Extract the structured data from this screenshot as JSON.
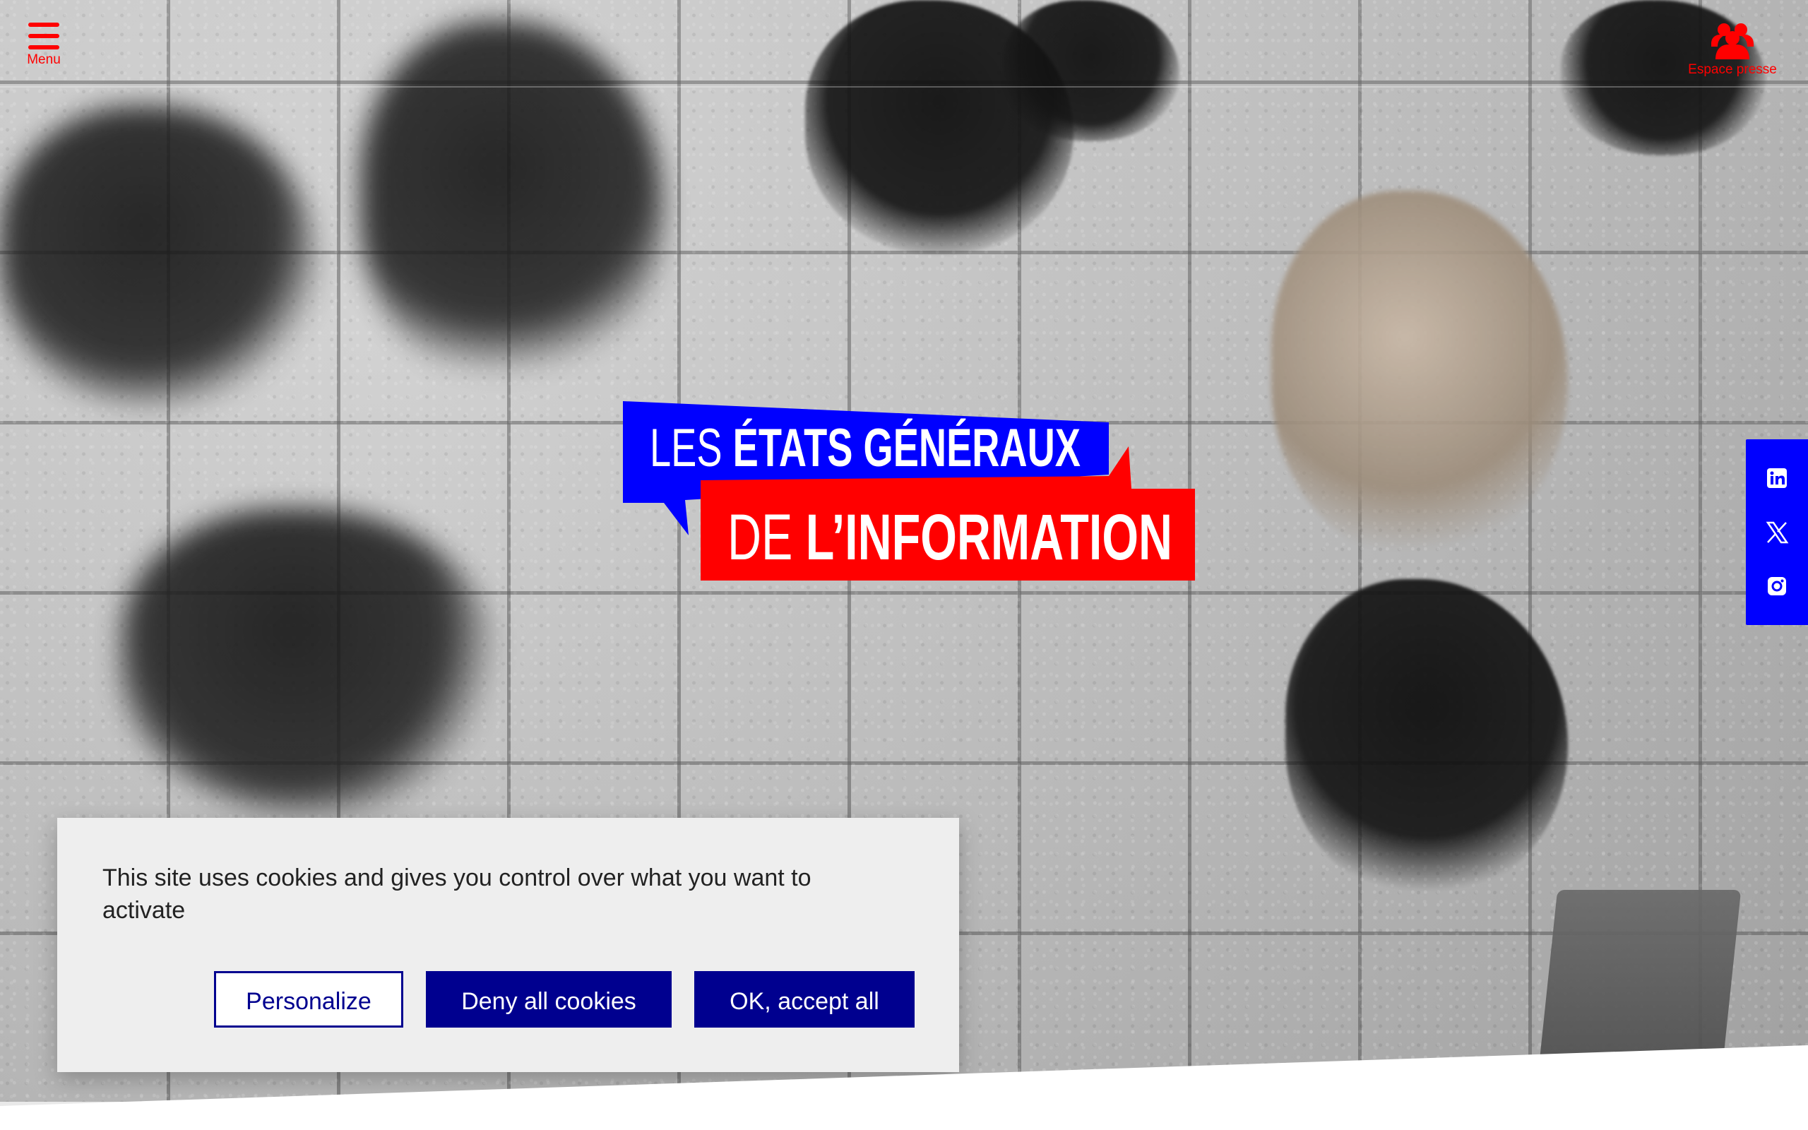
{
  "header": {
    "menu_label": "Menu",
    "press_label": "Espace presse"
  },
  "icons": {
    "menu": "menu-icon",
    "press": "press-group-icon",
    "linkedin": "linkedin-icon",
    "x": "x-icon",
    "instagram": "instagram-icon"
  },
  "logo": {
    "line1_light": "LES ",
    "line1_bold": "ÉTATS GÉNÉRAUX",
    "line2_light": "DE ",
    "line2_bold": "L’INFORMATION",
    "colors": {
      "blue": "#0000ff",
      "red": "#ff0000",
      "white": "#ffffff"
    }
  },
  "cookie_banner": {
    "message": "This site uses cookies and gives you control over what you want to activate",
    "buttons": {
      "personalize": "Personalize",
      "deny": "Deny all cookies",
      "accept": "OK, accept all"
    }
  },
  "background": {
    "partial_link_text": "s"
  },
  "colors": {
    "accent_red": "#ff0000",
    "accent_blue": "#0000ff",
    "cookie_button_blue": "#00008f"
  }
}
